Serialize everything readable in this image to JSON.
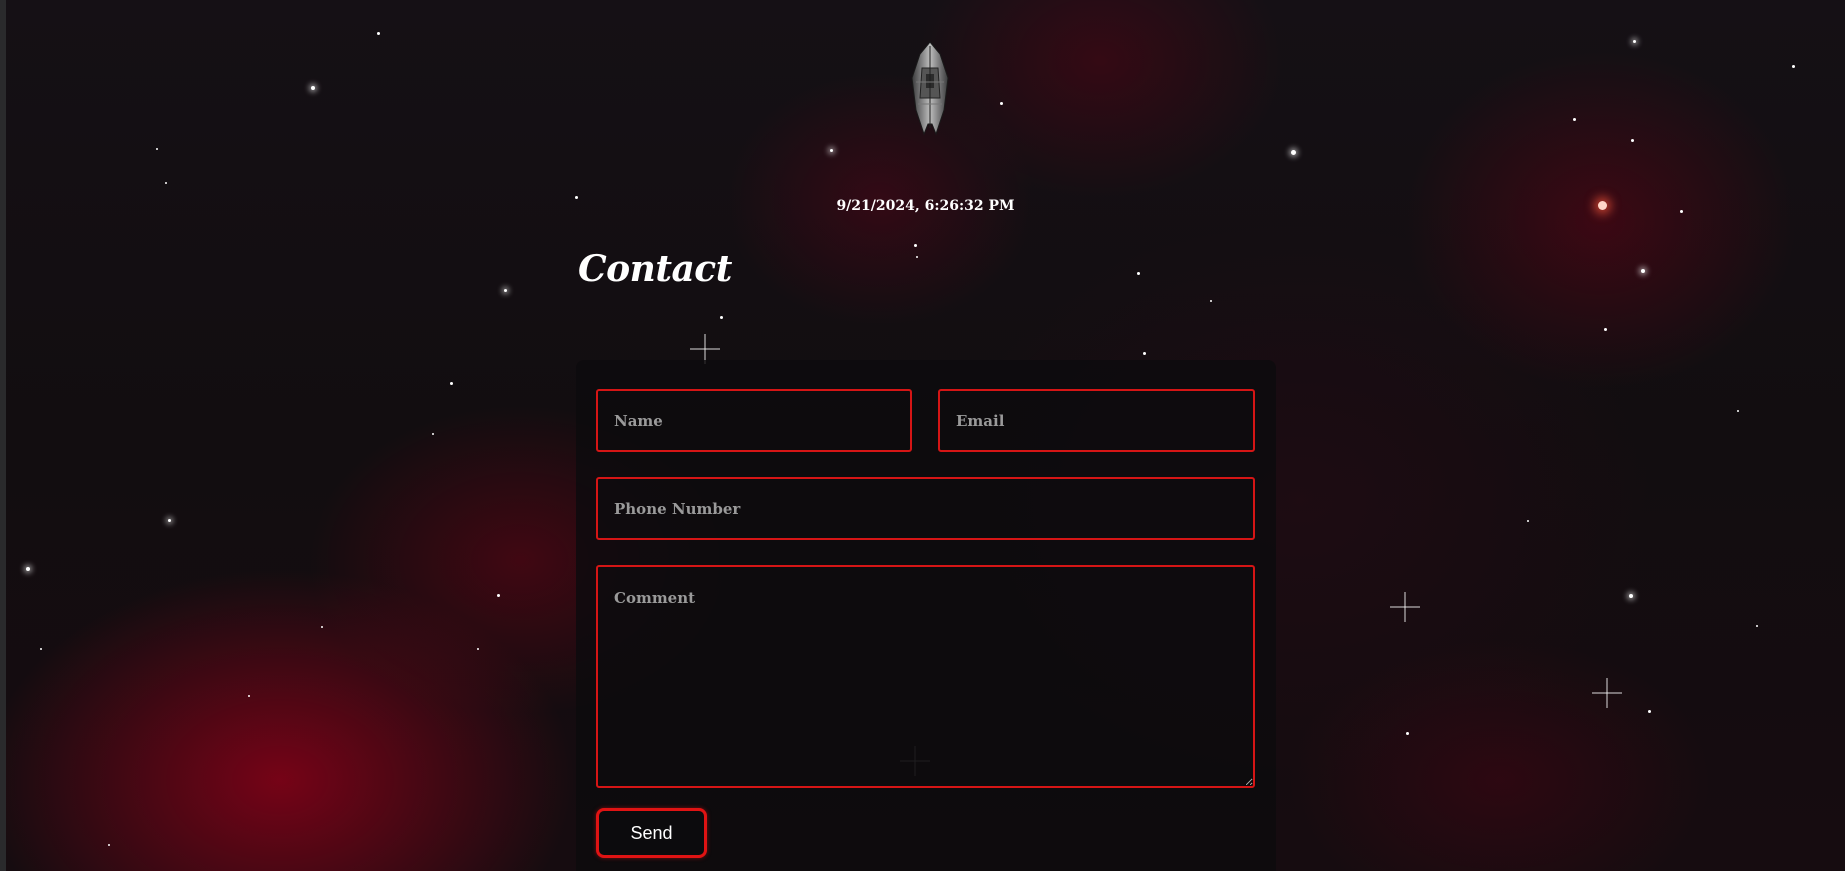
{
  "datetime": "9/21/2024, 6:26:32 PM",
  "page_title": "Contact",
  "form": {
    "name_placeholder": "Name",
    "email_placeholder": "Email",
    "phone_placeholder": "Phone Number",
    "comment_placeholder": "Comment",
    "send_label": "Send"
  },
  "colors": {
    "accent": "#d51515",
    "background": "#120d10",
    "text": "#ffffff",
    "placeholder": "#9a9a9a"
  },
  "icons": {
    "logo": "spaceship-logo-icon"
  }
}
